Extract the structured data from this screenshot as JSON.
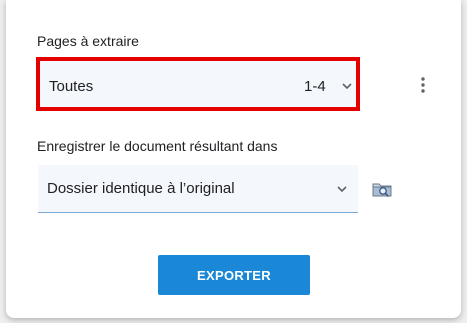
{
  "pages": {
    "label": "Pages à extraire",
    "selected_value": "Toutes",
    "range": "1-4",
    "highlight_color": "#e50000"
  },
  "destination": {
    "label": "Enregistrer le document résultant dans",
    "selected_value": "Dossier identique à l’original"
  },
  "actions": {
    "export_label": "EXPORTER"
  },
  "icons": {
    "more": "more-vert-icon",
    "folder": "folder-search-icon",
    "dropdown": "chevron-down-icon"
  },
  "colors": {
    "accent": "#1a88d6",
    "field_background": "#f4f7fb"
  }
}
